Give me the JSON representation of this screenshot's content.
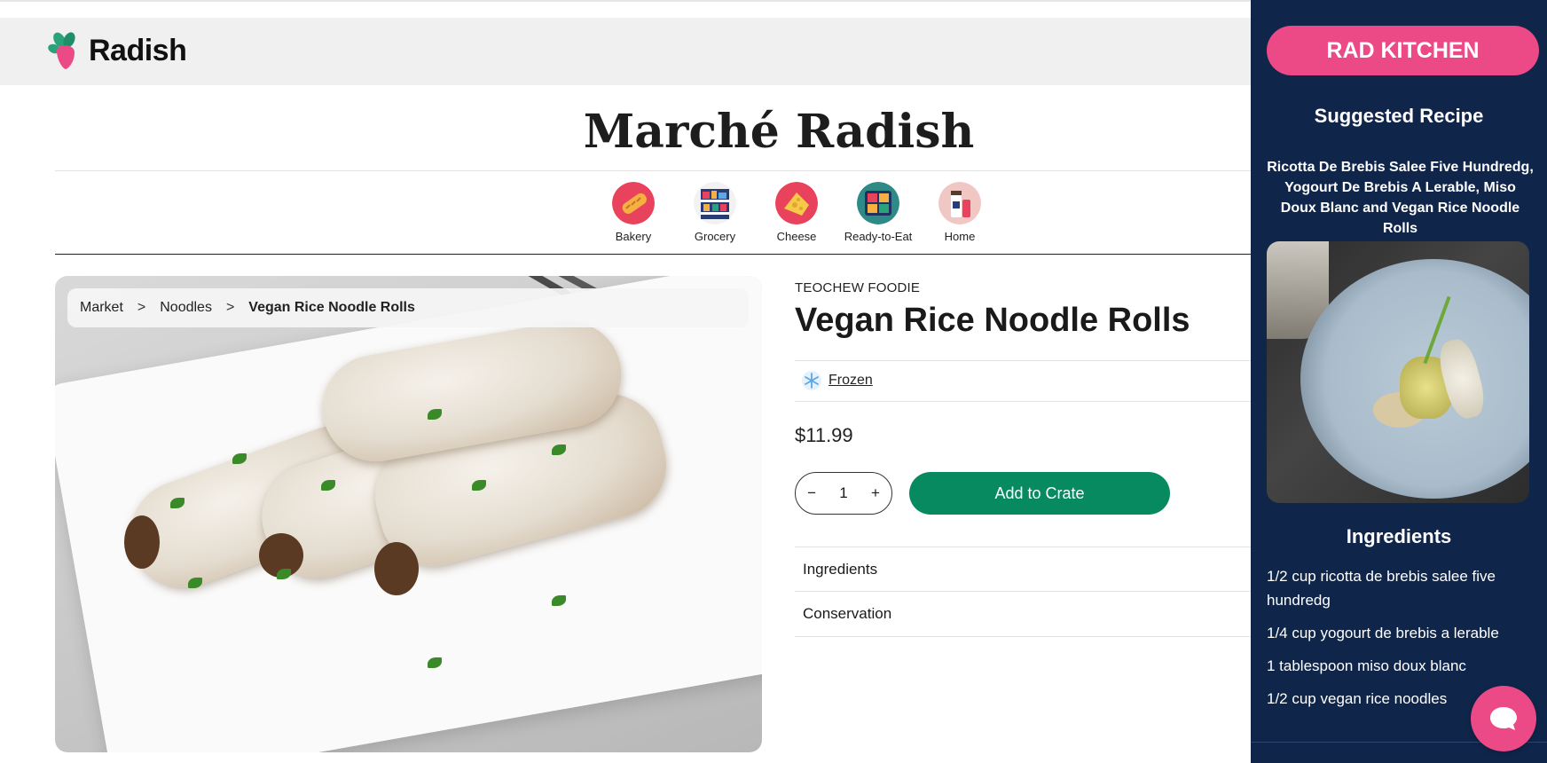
{
  "header": {
    "logo_text": "Radish"
  },
  "store": {
    "title": "Marché Radish"
  },
  "categories": [
    {
      "label": "Bakery",
      "icon": "bread-icon",
      "color": "#e8425c"
    },
    {
      "label": "Grocery",
      "icon": "shelves-icon",
      "color": "#2a3c74"
    },
    {
      "label": "Cheese",
      "icon": "cheese-icon",
      "color": "#e8425c"
    },
    {
      "label": "Ready-to-Eat",
      "icon": "meal-tray-icon",
      "color": "#2e8a86"
    },
    {
      "label": "Home",
      "icon": "home-goods-icon",
      "color": "#f0c7c2"
    }
  ],
  "breadcrumb": {
    "items": [
      "Market",
      "Noodles"
    ],
    "separator": ">",
    "current": "Vegan Rice Noodle Rolls"
  },
  "product": {
    "vendor": "TEOCHEW FOODIE",
    "title": "Vegan Rice Noodle Rolls",
    "tag": "Frozen",
    "price": "$11.99",
    "quantity": "1",
    "qty_minus": "−",
    "qty_plus": "+",
    "add_label": "Add to Crate",
    "accordions": [
      "Ingredients",
      "Conservation"
    ]
  },
  "panel": {
    "button_label": "RAD KITCHEN",
    "suggested_label": "Suggested Recipe",
    "recipe_name": "Ricotta De Brebis Salee Five Hundredg, Yogourt De Brebis A Lerable, Miso Doux Blanc and Vegan Rice Noodle Rolls",
    "ingredients_title": "Ingredients",
    "ingredients": [
      "1/2 cup ricotta de brebis salee five hundredg",
      "1/4 cup yogourt de brebis a lerable",
      "1 tablespoon miso doux blanc",
      "1/2 cup vegan rice noodles"
    ]
  },
  "colors": {
    "brand_pink": "#ec4a87",
    "panel_navy": "#0f254a",
    "add_green": "#078a5f",
    "frozen_blue": "#5aa9e6"
  }
}
